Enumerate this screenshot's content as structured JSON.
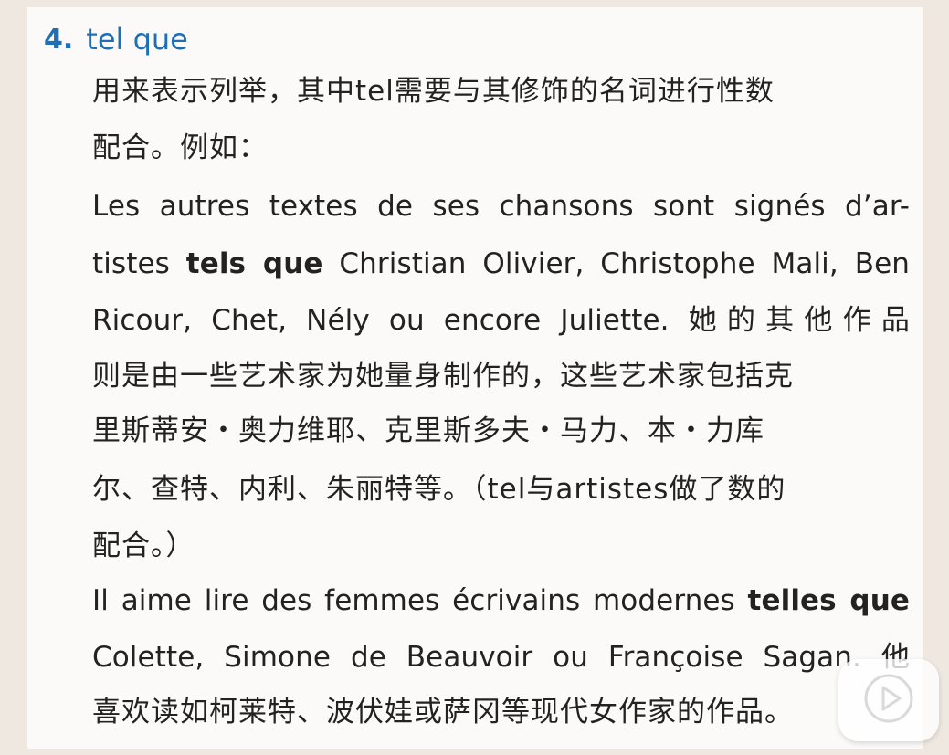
{
  "section": {
    "number": "4.",
    "term": "tel que"
  },
  "lines": [
    {
      "text": "用来表示列举，其中tel需要与其修饰的名词进行性数"
    },
    {
      "text": "配合。例如："
    },
    {
      "text": "Les autres textes de ses chansons sont signés d’ar-"
    },
    {
      "pre": "tistes ",
      "bold": "tels que",
      "post": " Christian Olivier, Christophe Mali, Ben"
    },
    {
      "text": "Ricour, Chet, Nély ou encore Juliette.  她的其他作品"
    },
    {
      "text": "则是由一些艺术家为她量身制作的，这些艺术家包括克"
    },
    {
      "text": "里斯蒂安・奥力维耶、克里斯多夫・马力、本・力库"
    },
    {
      "text": "尔、查特、内利、朱丽特等。（tel与artistes做了数的"
    },
    {
      "text": "配合。）"
    },
    {
      "pre": "Il aime lire des femmes écrivains modernes ",
      "bold": "telles que",
      "post": ""
    },
    {
      "text": "Colette, Simone de Beauvoir ou Françoise Sagan. 他"
    },
    {
      "text": "喜欢读如柯莱特、波伏娃或萨冈等现代女作家的作品。"
    }
  ],
  "overlay": {
    "icon": "play-icon"
  }
}
